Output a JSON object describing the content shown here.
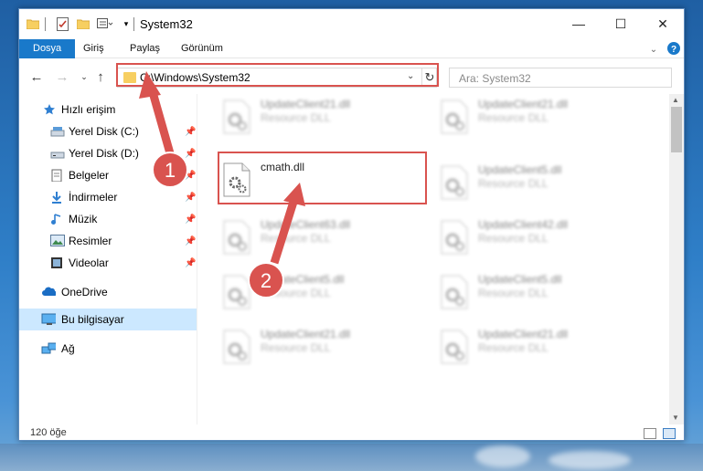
{
  "window": {
    "title": "System32"
  },
  "ribbon": {
    "tabs": [
      "Dosya",
      "Giriş",
      "Paylaş",
      "Görünüm"
    ]
  },
  "address": {
    "path": "C:\\Windows\\System32"
  },
  "search": {
    "placeholder": "Ara: System32"
  },
  "nav": {
    "quick_access": "Hızlı erişim",
    "items": [
      {
        "label": "Yerel Disk (C:)",
        "icon": "drive-icon"
      },
      {
        "label": "Yerel Disk (D:)",
        "icon": "drive-icon"
      },
      {
        "label": "Belgeler",
        "icon": "documents-icon"
      },
      {
        "label": "İndirmeler",
        "icon": "downloads-icon"
      },
      {
        "label": "Müzik",
        "icon": "music-icon"
      },
      {
        "label": "Resimler",
        "icon": "pictures-icon"
      },
      {
        "label": "Videolar",
        "icon": "videos-icon"
      }
    ],
    "onedrive": "OneDrive",
    "this_pc": "Bu bilgisayar",
    "network": "Ağ"
  },
  "files": {
    "left": [
      {
        "name": "UpdateClient21.dll",
        "type": "Resource DLL"
      },
      {
        "name": "cmath.dll",
        "type": ""
      },
      {
        "name": "UpdateClient63.dll",
        "type": "Resource DLL"
      },
      {
        "name": "UpdateClient5.dll",
        "type": "Resource DLL"
      },
      {
        "name": "UpdateClient21.dll",
        "type": "Resource DLL"
      }
    ],
    "right": [
      {
        "name": "UpdateClient21.dll",
        "type": "Resource DLL"
      },
      {
        "name": "UpdateClient5.dll",
        "type": "Resource DLL"
      },
      {
        "name": "UpdateClient42.dll",
        "type": "Resource DLL"
      },
      {
        "name": "UpdateClient5.dll",
        "type": "Resource DLL"
      },
      {
        "name": "UpdateClient21.dll",
        "type": "Resource DLL"
      }
    ]
  },
  "status": {
    "count": "120 öğe"
  },
  "annotations": {
    "step1": "1",
    "step2": "2"
  },
  "colors": {
    "accent": "#1979ca",
    "highlight": "#d9534f",
    "selection": "#cce8ff"
  }
}
